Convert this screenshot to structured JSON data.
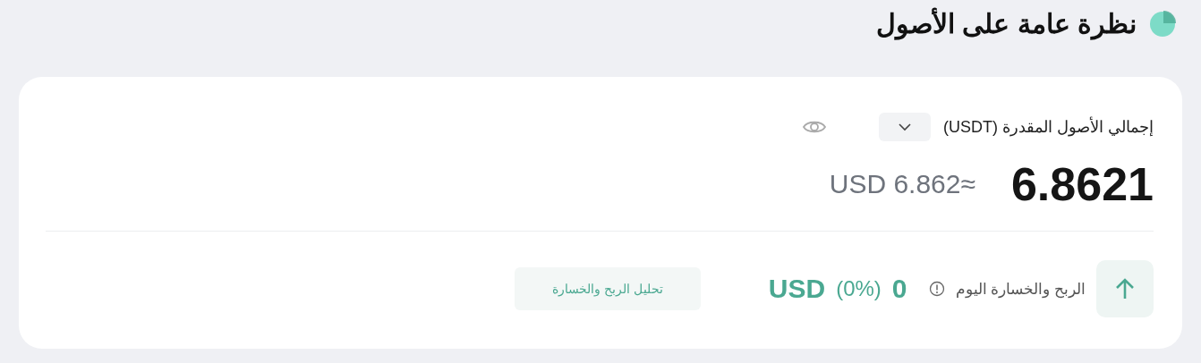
{
  "header": {
    "title": "نظرة عامة على الأصول"
  },
  "summary": {
    "label": "إجمالي الأصول المقدرة (USDT)",
    "balance": "6.8621",
    "converted": "USD 6.862≈"
  },
  "pnl": {
    "label": "الربح والخسارة اليوم",
    "amount": "0",
    "percent": "(0%)",
    "currency": "USD",
    "analysis_button": "تحليل الربح والخسارة"
  }
}
